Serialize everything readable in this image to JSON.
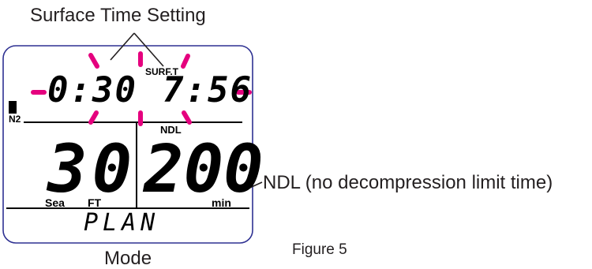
{
  "callouts": {
    "surface_time_setting": "Surface Time Setting",
    "ndl": "NDL (no decompression limit time)",
    "mode": "Mode",
    "figure": "Figure 5"
  },
  "display": {
    "elapsed_time": "0:30",
    "surface_label": "SURF.T",
    "surface_time": "7:56",
    "n2_label": "N2",
    "ndl_label": "NDL",
    "depth": "30",
    "ndl_value": "200",
    "sea_label": "Sea",
    "depth_unit": "FT",
    "ndl_unit": "min",
    "mode": "PLAN"
  },
  "colors": {
    "blink_marks": "#e5007e",
    "lcd_border": "#2e3192",
    "segments": "#000000"
  }
}
